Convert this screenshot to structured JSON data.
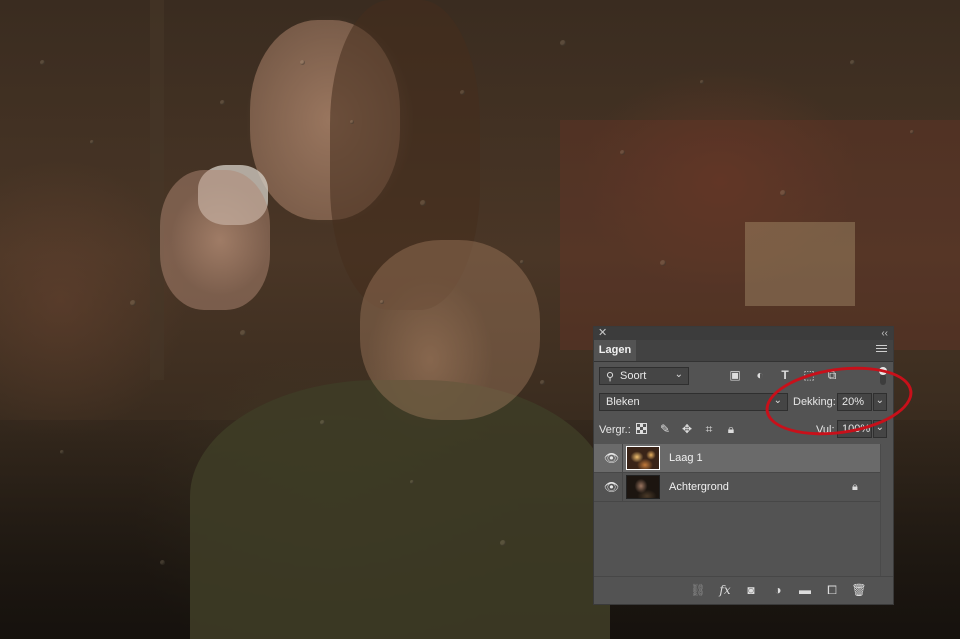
{
  "panel": {
    "tab_label": "Lagen",
    "filter": {
      "kind_label": "Soort",
      "type_glyph": "T"
    },
    "blend_mode": "Bleken",
    "opacity_label": "Dekking:",
    "opacity_value": "20%",
    "lock_label": "Vergr.:",
    "fill_label": "Vul:",
    "fill_value": "100%",
    "footer": {
      "fx_label": "fx"
    }
  },
  "layers": [
    {
      "name": "Laag 1",
      "selected": true,
      "visible": true,
      "locked": false
    },
    {
      "name": "Achtergrond",
      "selected": false,
      "visible": true,
      "locked": true
    }
  ],
  "icons": {
    "close": "close-icon",
    "collapse": "collapse-icon",
    "panel_menu": "panel-menu-icon",
    "eye": "eye-icon",
    "lock": "lock-icon"
  },
  "colors": {
    "panel_bg": "#535353",
    "selected_row": "#6a6a6a",
    "annotation_red": "#c8101a"
  }
}
